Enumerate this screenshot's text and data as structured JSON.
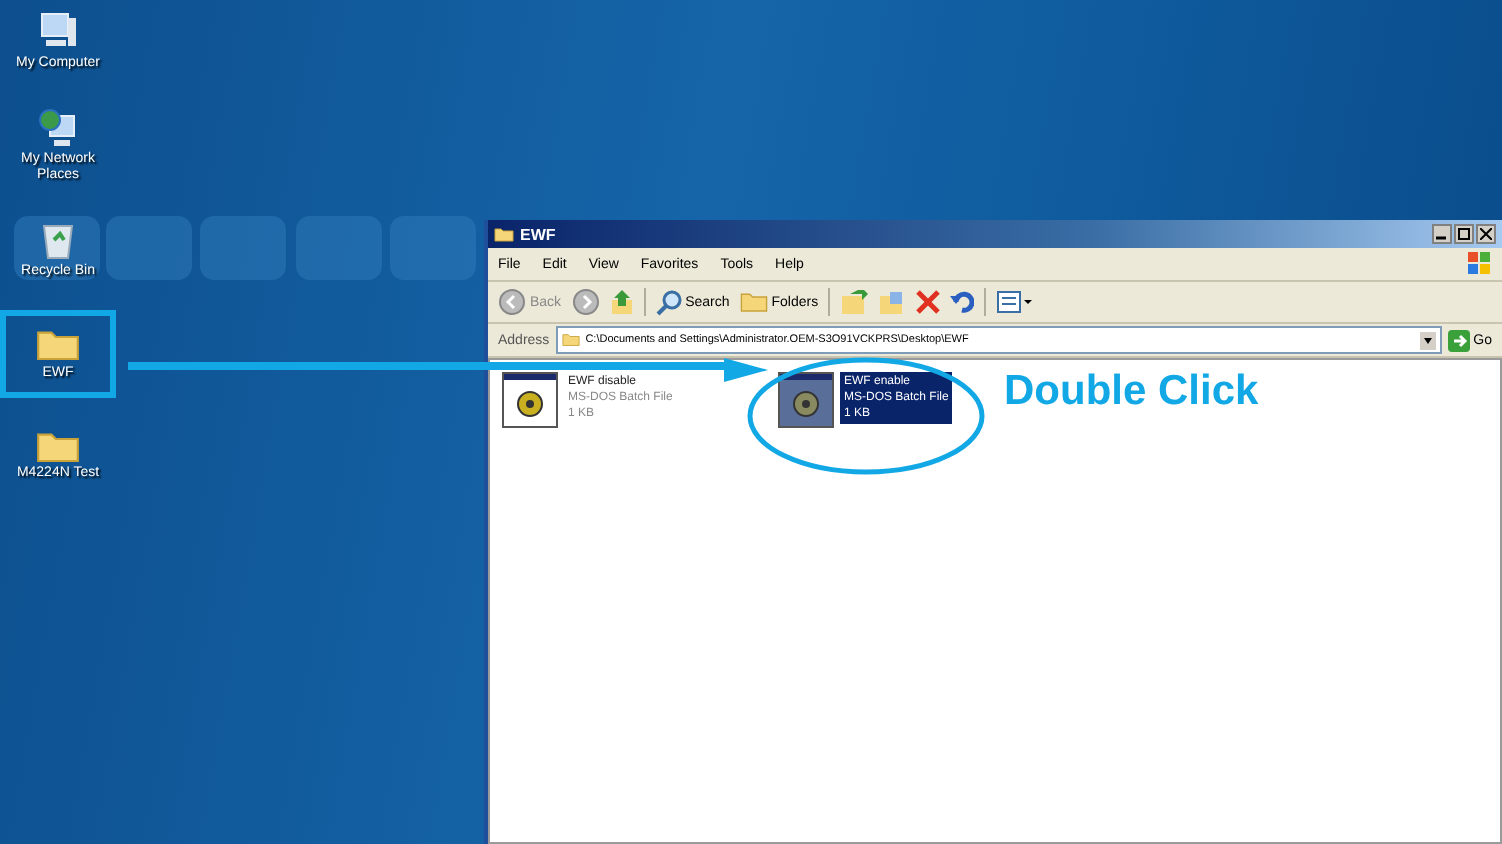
{
  "desktop_icons": [
    {
      "label": "My Computer",
      "kind": "computer",
      "highlighted": false
    },
    {
      "label": "My Network Places",
      "kind": "network",
      "highlighted": false
    },
    {
      "label": "Recycle Bin",
      "kind": "recycle",
      "highlighted": false
    },
    {
      "label": "EWF",
      "kind": "folder",
      "highlighted": true
    },
    {
      "label": "M4224N Test",
      "kind": "folder",
      "highlighted": false
    }
  ],
  "window": {
    "title": "EWF",
    "menu": [
      "File",
      "Edit",
      "View",
      "Favorites",
      "Tools",
      "Help"
    ],
    "toolbar": [
      {
        "kind": "back",
        "label": "Back"
      },
      {
        "kind": "forward"
      },
      {
        "kind": "up"
      },
      {
        "kind": "search",
        "label": "Search"
      },
      {
        "kind": "folders",
        "label": "Folders"
      },
      {
        "kind": "move"
      },
      {
        "kind": "copy"
      },
      {
        "kind": "delete"
      },
      {
        "kind": "undo"
      },
      {
        "kind": "views"
      }
    ],
    "address_label": "Address",
    "address": "C:\\Documents and Settings\\Administrator.OEM-S3O91VCKPRS\\Desktop\\EWF",
    "go": "Go",
    "files": [
      {
        "name": "EWF disable",
        "type": "MS-DOS Batch File",
        "size": "1 KB",
        "selected": false
      },
      {
        "name": "EWF enable",
        "type": "MS-DOS Batch File",
        "size": "1 KB",
        "selected": true
      }
    ]
  },
  "annotation": {
    "text": "Double Click"
  }
}
